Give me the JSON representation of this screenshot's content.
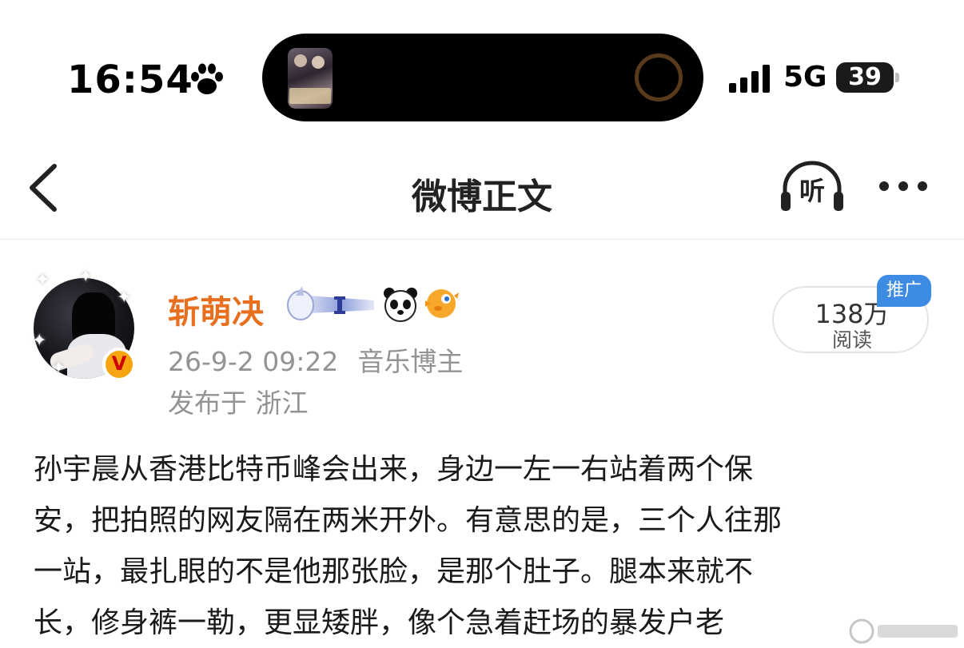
{
  "status_bar": {
    "time": "16:54",
    "network": "5G",
    "battery": "39",
    "icons": [
      "paw-icon",
      "signal-icon"
    ]
  },
  "nav": {
    "title": "微博正文",
    "listen_label": "听",
    "icons": [
      "back-chevron-icon",
      "headphones-icon",
      "more-dots-icon"
    ]
  },
  "author": {
    "name": "斩萌决",
    "timestamp": "26-9-2 09:22",
    "role": "音乐博主",
    "location": "发布于 浙江",
    "verified_badge": "V",
    "badge_icons": [
      "unicorn-medal-icon",
      "panda-emoji-icon",
      "pufferfish-emoji-icon"
    ]
  },
  "stats": {
    "reads_count": "138万",
    "reads_label": "阅读",
    "promo_label": "推广"
  },
  "post": {
    "lines": [
      "孙宇晨从香港比特币峰会出来，身边一左一右站着两个保",
      "安，把拍照的网友隔在两米开外。有意思的是，三个人往那",
      "一站，最扎眼的不是他那张脸，是那个肚子。腿本来就不",
      "长，修身裤一勒，更显矮胖，像个急着赶场的暴发户老"
    ]
  },
  "colors": {
    "author_name": "#e86f1e",
    "meta_gray": "#939393",
    "promo_blue": "#3e8be4",
    "verified_gold": "#f7a511"
  }
}
